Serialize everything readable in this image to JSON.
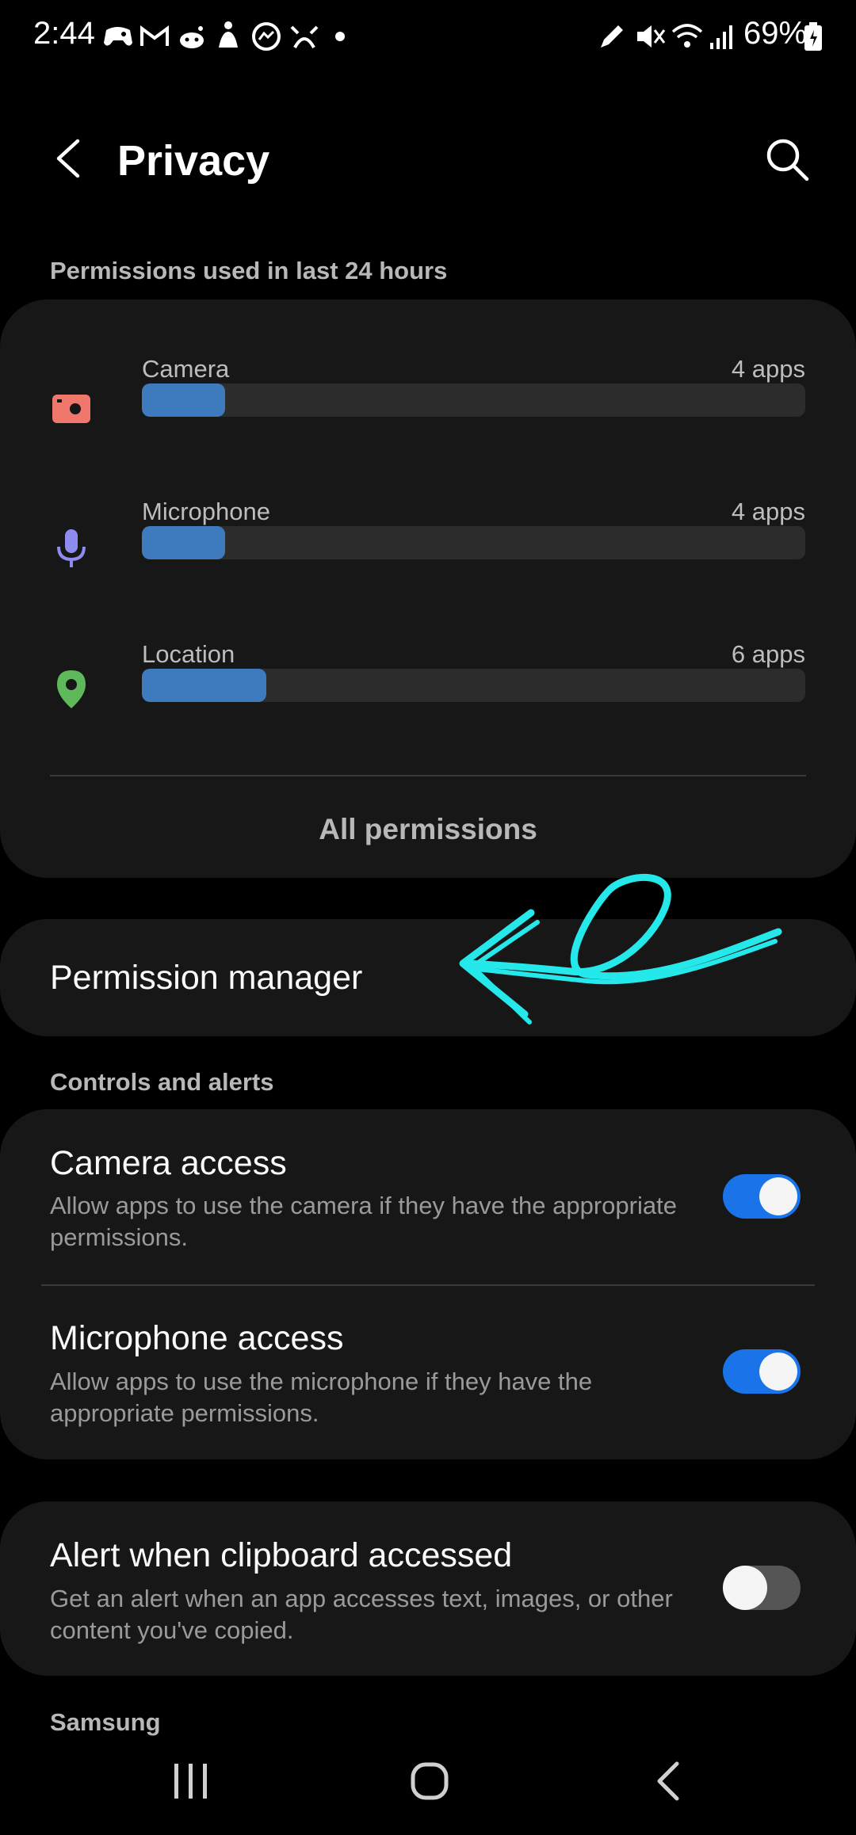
{
  "status_bar": {
    "time": "2:44",
    "battery": "69%",
    "left_icons": [
      "game-controller-icon",
      "gmail-icon",
      "reddit-icon",
      "accessibility-icon",
      "messenger-icon",
      "app-icon",
      "dot-icon"
    ],
    "right_icons": [
      "pen-icon",
      "mute-icon",
      "wifi-icon",
      "signal-icon",
      "battery-icon"
    ]
  },
  "header": {
    "title": "Privacy"
  },
  "usage": {
    "section_label": "Permissions used in last 24 hours",
    "items": [
      {
        "label": "Camera",
        "count": "4 apps",
        "icon": "camera-icon",
        "color": "#f0776c",
        "fraction": 0.125
      },
      {
        "label": "Microphone",
        "count": "4 apps",
        "icon": "microphone-icon",
        "color": "#8f8cf0",
        "fraction": 0.125
      },
      {
        "label": "Location",
        "count": "6 apps",
        "icon": "location-pin-icon",
        "color": "#5fb85a",
        "fraction": 0.187
      }
    ],
    "all_permissions_label": "All permissions",
    "bar_color": "#3e7bbe"
  },
  "permission_manager": {
    "label": "Permission manager"
  },
  "controls": {
    "section_label": "Controls and alerts",
    "items": [
      {
        "title": "Camera access",
        "description": "Allow apps to use the camera if they have the appropriate permissions.",
        "enabled": true
      },
      {
        "title": "Microphone access",
        "description": "Allow apps to use the microphone if they have the appropriate permissions.",
        "enabled": true
      }
    ]
  },
  "clipboard": {
    "title": "Alert when clipboard accessed",
    "description": "Get an alert when an app accesses text, images, or other content you've copied.",
    "enabled": false
  },
  "samsung_label": "Samsung",
  "nav": [
    "recents-button",
    "home-button",
    "back-button"
  ],
  "annotation_color": "#25e8ea",
  "accent_color": "#1a73e8"
}
